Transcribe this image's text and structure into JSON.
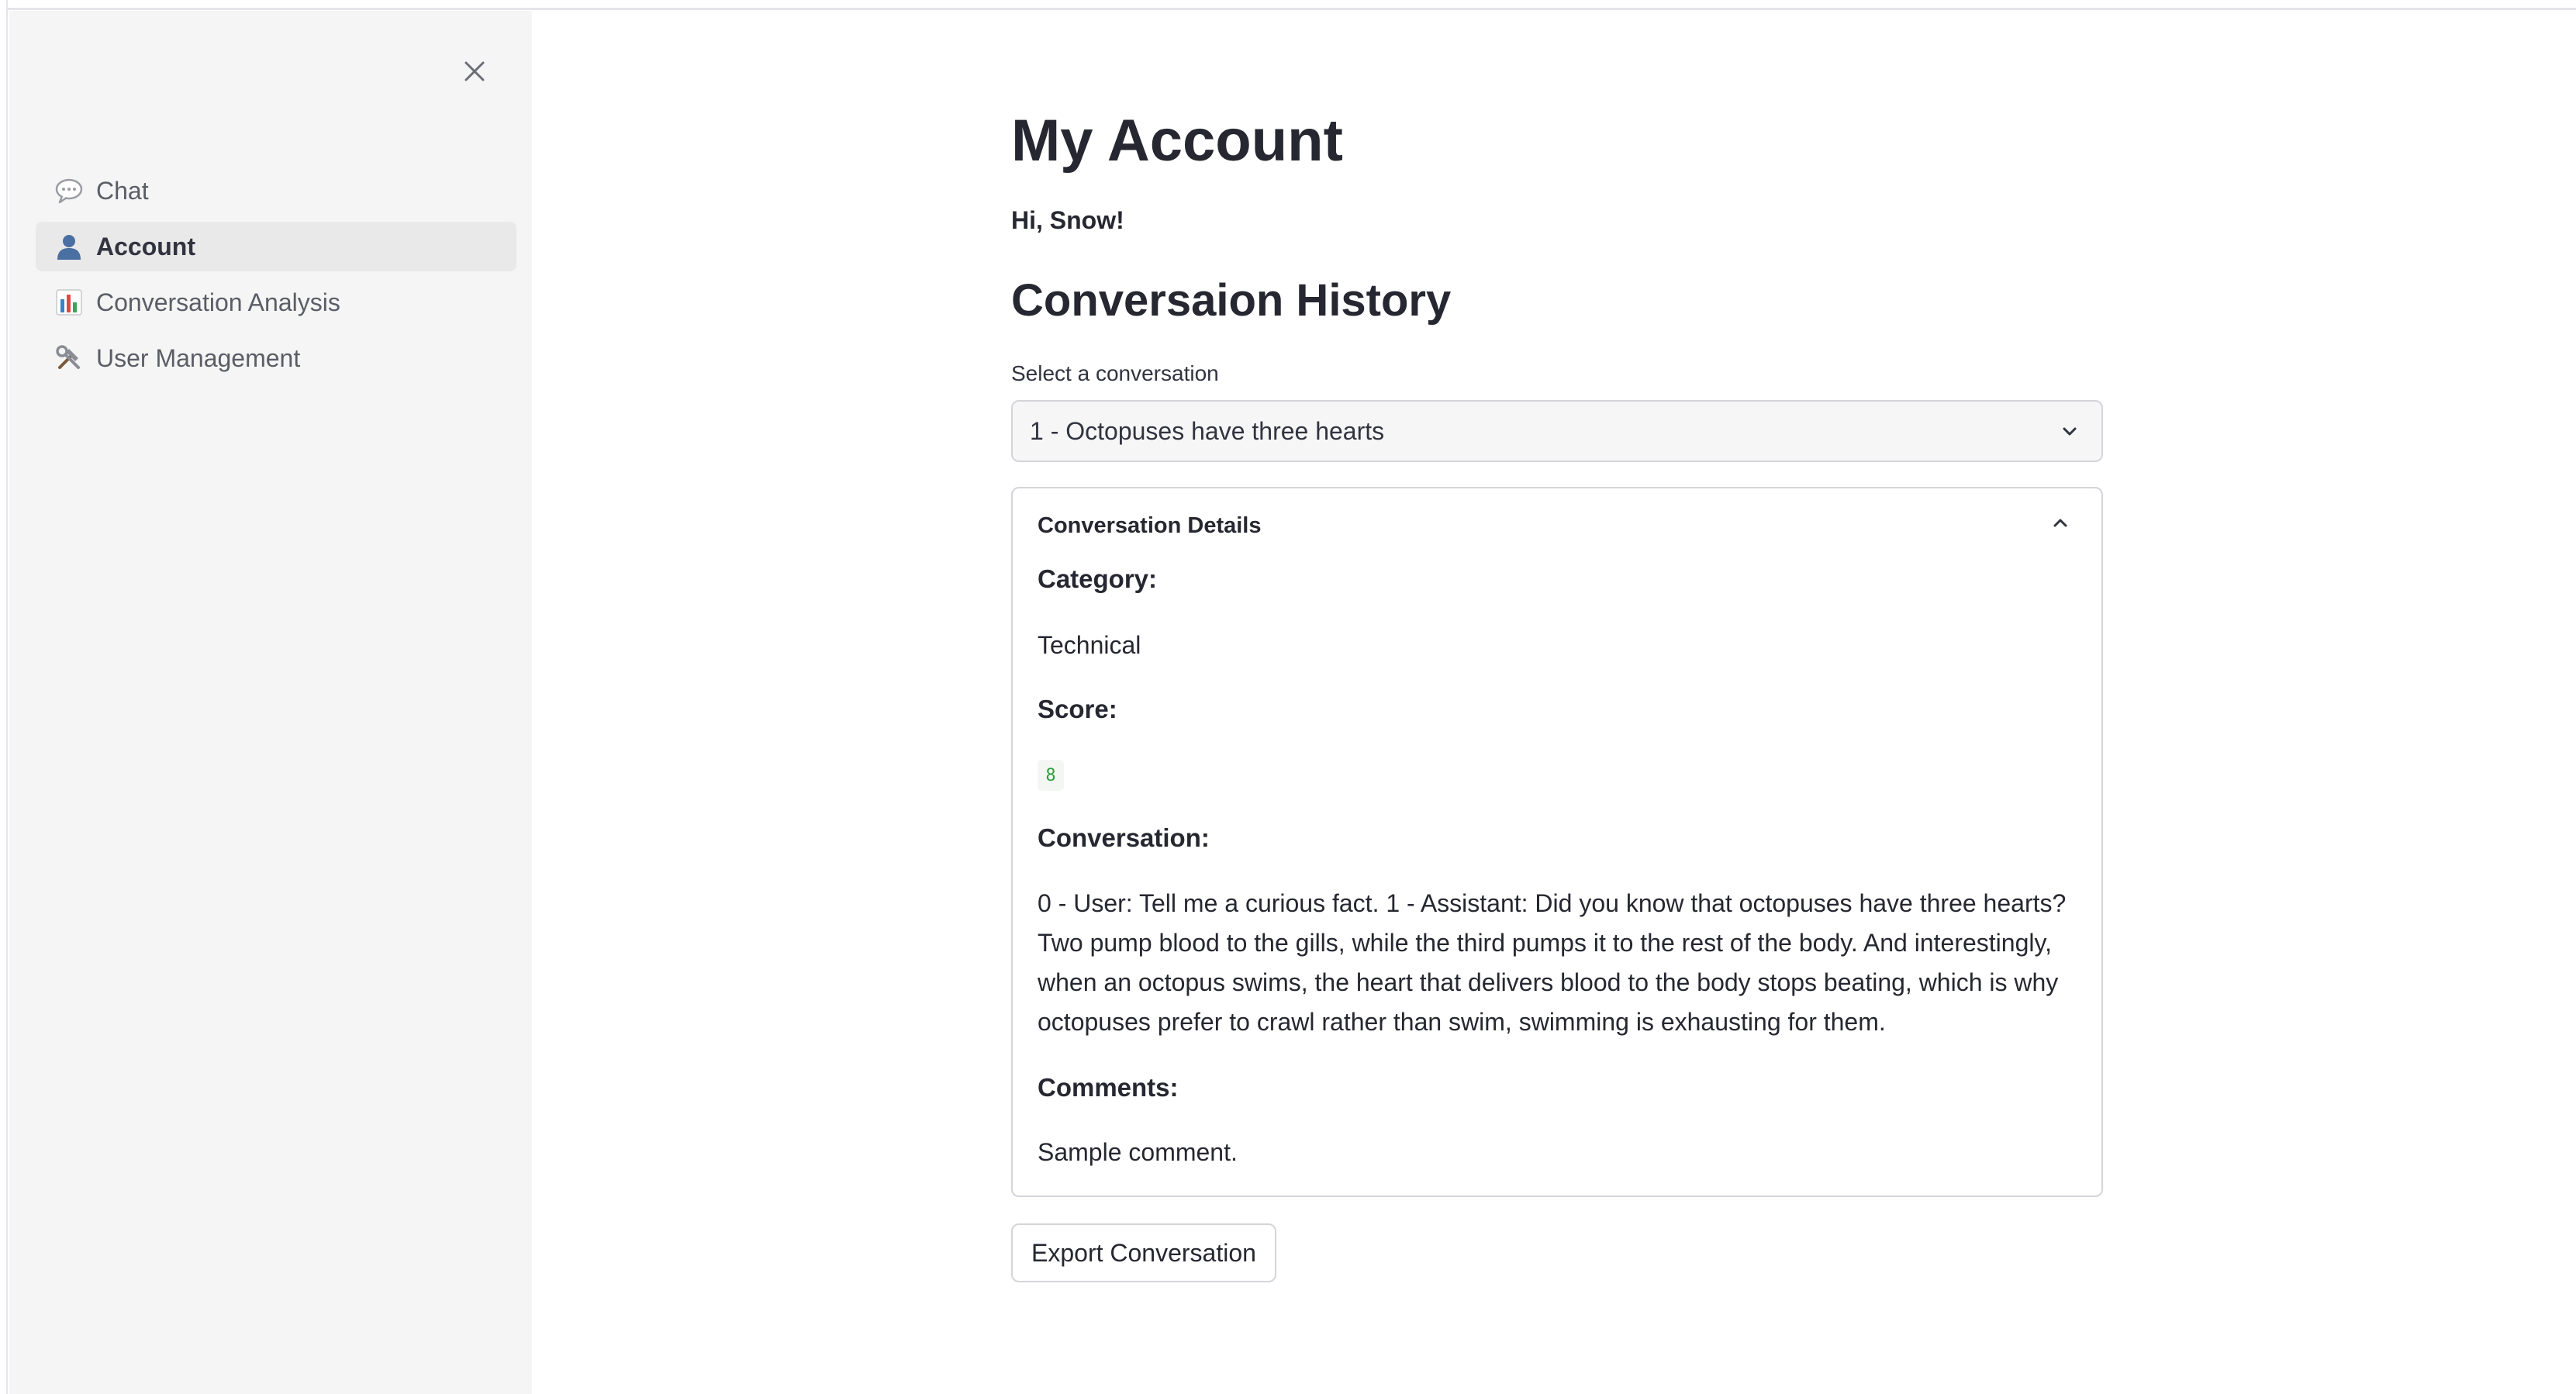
{
  "sidebar": {
    "close_icon": "close-icon",
    "items": [
      {
        "icon": "speech-bubble-icon",
        "label": "Chat",
        "active": false
      },
      {
        "icon": "user-icon",
        "label": "Account",
        "active": true
      },
      {
        "icon": "bar-chart-icon",
        "label": "Conversation Analysis",
        "active": false
      },
      {
        "icon": "tools-icon",
        "label": "User Management",
        "active": false
      }
    ]
  },
  "main": {
    "title": "My Account",
    "greeting": "Hi, Snow!",
    "section_title": "Conversaion History",
    "select": {
      "label": "Select a conversation",
      "value": "1 - Octopuses have three hearts",
      "icon": "chevron-down-icon"
    },
    "details": {
      "title": "Conversation Details",
      "icon": "chevron-up-icon",
      "category_label": "Category:",
      "category_value": "Technical",
      "score_label": "Score:",
      "score_value": "8",
      "conversation_label": "Conversation:",
      "conversation_text": "0 - User: Tell me a curious fact. 1 - Assistant: Did you know that octopuses have three hearts? Two pump blood to the gills, while the third pumps it to the rest of the body. And interestingly, when an octopus swims, the heart that delivers blood to the body stops beating, which is why octopuses prefer to crawl rather than swim, swimming is exhausting for them.",
      "comments_label": "Comments:",
      "comments_value": "Sample comment."
    },
    "export_label": "Export Conversation"
  },
  "colors": {
    "sidebar_bg": "#f5f5f5",
    "active_item_bg": "#e9e9ea",
    "score_green": "#2e9e3c",
    "border": "#d4d5d9"
  }
}
